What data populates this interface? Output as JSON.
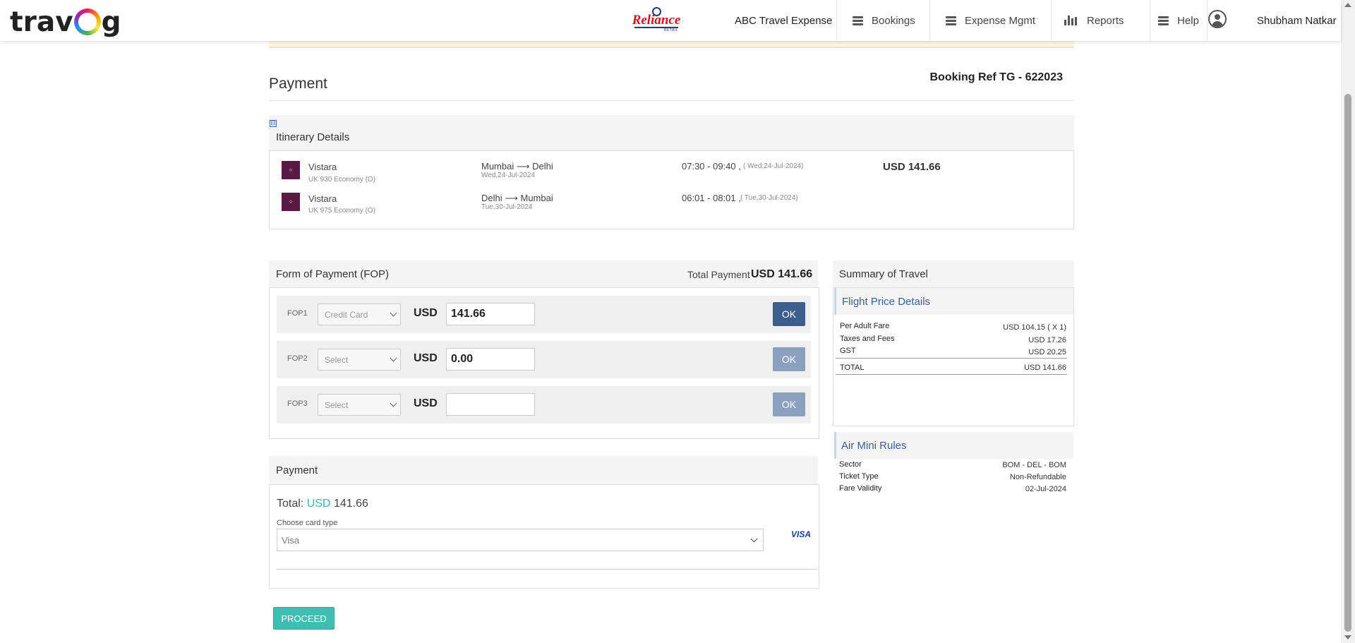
{
  "header": {
    "company": "ABC Travel Expense",
    "nav": [
      "Bookings",
      "Expense Mgmt",
      "Reports",
      "Help"
    ],
    "user": "Shubham Natkar",
    "partner_logo_text": "Reliance",
    "partner_logo_sub": "RETAIL"
  },
  "page": {
    "title": "Payment",
    "booking_ref": "Booking Ref TG - 622023"
  },
  "itinerary": {
    "title": "Itinerary Details",
    "collapse_symbol": "⊟",
    "segments": [
      {
        "airline": "Vistara",
        "flight": "UK 930 Economy (O)",
        "route": "Mumbai ⟶ Delhi",
        "date": "Wed,24-Jul-2024",
        "time": "07:30 - 09:40 ,",
        "time_date": "( Wed,24-Jul-2024)",
        "price": "USD 141.66"
      },
      {
        "airline": "Vistara",
        "flight": "UK 975 Economy (O)",
        "route": "Delhi ⟶ Mumbai",
        "date": "Tue,30-Jul-2024",
        "time": "06:01 - 08:01 ,",
        "time_date": "( Tue,30-Jul-2024)"
      }
    ]
  },
  "fop": {
    "title": "Form of Payment (FOP)",
    "total_label": "Total Payment",
    "total_value": "USD 141.66",
    "currency": "USD",
    "ok_label": "OK",
    "rows": [
      {
        "label": "FOP1",
        "select": "Credit Card",
        "amount": "141.66"
      },
      {
        "label": "FOP2",
        "select": "Select",
        "amount": "0.00"
      },
      {
        "label": "FOP3",
        "select": "Select",
        "amount": ""
      }
    ]
  },
  "payment": {
    "title": "Payment",
    "total_prefix": "Total:",
    "total_currency": "USD",
    "total_amount": "141.66",
    "card_label": "Choose card type",
    "card_value": "Visa",
    "card_logo": "VISA",
    "proceed_label": "PROCEED"
  },
  "summary": {
    "title": "Summary of Travel",
    "price_title": "Flight Price Details",
    "price_rows": [
      {
        "label": "Per Adult Fare",
        "value": "USD 104.15 ( X 1)"
      },
      {
        "label": "Taxes and Fees",
        "value": "USD 17.26"
      },
      {
        "label": "GST",
        "value": "USD 20.25"
      }
    ],
    "total_label": "TOTAL",
    "total_value": "USD 141.66",
    "rules_title": "Air Mini Rules",
    "rules": [
      {
        "label": "Sector",
        "value": "BOM - DEL - BOM"
      },
      {
        "label": "Ticket Type",
        "value": "Non-Refundable"
      },
      {
        "label": "Fare Validity",
        "value": "02-Jul-2024"
      }
    ]
  },
  "colors": {
    "ok_active": "#3d5e8c",
    "ok_inactive": "#8aa0bc",
    "proceed": "#3ebdb0",
    "accent_currency": "#3bb3a8"
  }
}
